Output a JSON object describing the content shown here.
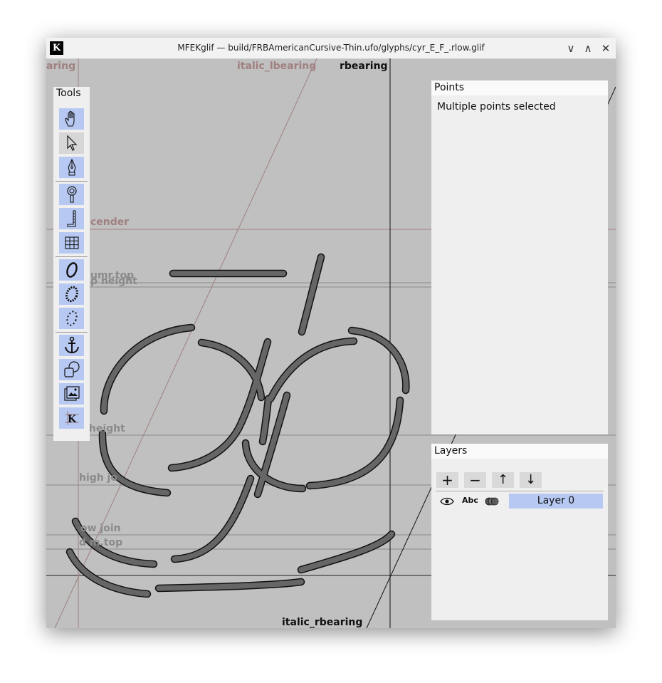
{
  "window": {
    "app_icon": "K",
    "title": "MFEKglif — build/FRBAmericanCursive-Thin.ufo/glyphs/cyr_E_F_.rlow.glif",
    "minimize_glyph": "∨",
    "maximize_glyph": "∧",
    "close_glyph": "✕"
  },
  "guides": {
    "bearing_cut": "aring",
    "italic_lbearing": "italic_lbearing",
    "rbearing": "rbearing",
    "ascender_cut": "cender",
    "num_top_cut": "umr.top",
    "cap_height_cut": "p height",
    "x_height": "x height",
    "high_join_cut": "high jo",
    "low_join_cut": "ow join",
    "denom_top_cut": "d  m.top",
    "italic_rbearing": "italic_rbearing"
  },
  "tools_panel": {
    "title": "Tools",
    "items": [
      {
        "name": "pan-tool",
        "icon": "hand-icon"
      },
      {
        "name": "select-tool",
        "icon": "pointer-icon",
        "selected": true
      },
      {
        "name": "pen-tool",
        "icon": "pen-nib-icon"
      },
      {
        "name": "zoom-tool",
        "icon": "magnifier-icon"
      },
      {
        "name": "measure-tool",
        "icon": "ruler-icon"
      },
      {
        "name": "grid-tool",
        "icon": "grid-icon"
      },
      {
        "name": "variable-width-stroke-tool",
        "icon": "vws-ellipse-icon"
      },
      {
        "name": "pattern-along-path-tool",
        "icon": "dotted-ellipse-icon"
      },
      {
        "name": "dash-along-path-tool",
        "icon": "dashed-ellipse-icon"
      },
      {
        "name": "anchor-tool",
        "icon": "anchor-icon"
      },
      {
        "name": "shapes-tool",
        "icon": "shapes-icon"
      },
      {
        "name": "image-tool",
        "icon": "image-icon"
      },
      {
        "name": "guidelines-tool",
        "icon": "k-guidelines-icon"
      }
    ]
  },
  "points_panel": {
    "title": "Points",
    "message": "Multiple points selected"
  },
  "layers_panel": {
    "title": "Layers",
    "add_glyph": "+",
    "remove_glyph": "−",
    "move_up_glyph": "↑",
    "move_down_glyph": "↓",
    "abc_label": "Abc",
    "layer_name": "Layer 0"
  },
  "colors": {
    "canvas_bg": "#c0c0c0",
    "panel_bg": "#efefef",
    "tool_bg": "#b7c9f2",
    "guide_red": "#a08080",
    "guide_gray": "#8a8a8a",
    "stroke_fill": "#666666"
  }
}
